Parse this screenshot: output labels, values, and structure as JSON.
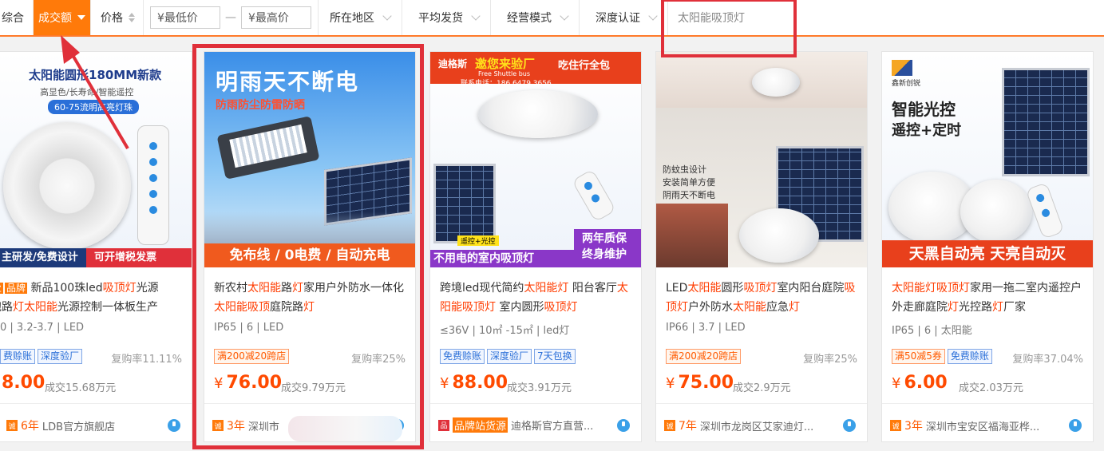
{
  "filter_bar": {
    "first_item": "综合",
    "active_sort": "成交额",
    "price_sort": "价格",
    "min_price_placeholder": "¥最低价",
    "price_sep": "—",
    "max_price_placeholder": "¥最高价",
    "region": "所在地区",
    "avg_ship": "平均发货",
    "biz_mode": "经营模式",
    "deep_cert": "深度认证",
    "search_value": "太阳能吸顶灯"
  },
  "colors": {
    "accent": "#ff7a0a",
    "highlight": "#ff3c00",
    "frame_red": "#e0303a",
    "tag_blue": "#2a6fd8"
  },
  "products": [
    {
      "image_text": [
        "太阳能圆形180MM新款",
        "高显色/长寿命/智能遥控",
        "60-75流明高亮灯珠",
        "主研发/免费设计",
        "可开增税发票"
      ],
      "title_parts": [
        "",
        "新品100珠led",
        "吸顶灯",
        "光源",
        "",
        "",
        "泡路",
        "灯",
        "太阳能",
        "光源控制一体板生产"
      ],
      "badges": [
        "业",
        "品牌"
      ],
      "spec": "0 | 3.2-3.7 | LED",
      "tags": [
        {
          "text": "费赊账",
          "style": "blue"
        },
        {
          "text": "深度验厂",
          "style": "blue"
        }
      ],
      "rebuy": "复购率11.11%",
      "price": "8.00",
      "deal": "成交15.68万元",
      "years": "6年",
      "shop": "LDB官方旗舰店"
    },
    {
      "image_text": [
        "明雨天不断电",
        "防雨防尘防雷防晒",
        "免布线 / 0电费 / 自动充电"
      ],
      "title_parts": [
        "新农村",
        "太阳能",
        "路",
        "灯",
        "家用户外防水一体化",
        "太阳能",
        "吸顶",
        "庭院路",
        "灯",
        ""
      ],
      "spec": "IP65 | 6 | LED",
      "tags": [
        {
          "text": "满200减20跨店",
          "style": "orange"
        }
      ],
      "rebuy": "复购率25%",
      "price": "76.00",
      "deal": "成交9.79万元",
      "years": "3年",
      "shop": "深圳市"
    },
    {
      "image_text": [
        "迪格斯",
        "邀您来验厂",
        "吃住行全包",
        "Free Shuttle bus",
        "联系电话：186 6479 3656",
        "遥控+光控",
        "两年质保",
        "终身维护",
        "不用电的室内吸顶灯"
      ],
      "title_parts": [
        "跨境led现代简约",
        "太阳能灯",
        " 阳台客厅",
        "太阳能吸顶灯",
        " 室内圆形",
        "吸顶灯",
        "",
        "",
        "",
        ""
      ],
      "spec": "≤36V | 10㎡ -15㎡ | led灯",
      "tags": [
        {
          "text": "免费赊账",
          "style": "blue"
        },
        {
          "text": "深度验厂",
          "style": "blue"
        },
        {
          "text": "7天包换",
          "style": "blue"
        }
      ],
      "rebuy": "",
      "price": "88.00",
      "deal": "成交3.91万元",
      "years": "品牌站货源",
      "shop": "迪格斯官方直营..."
    },
    {
      "image_text": [
        "防蚊虫设计",
        "安装简单方便",
        "阴雨天不断电"
      ],
      "title_parts": [
        "LED",
        "太阳能",
        "圆形",
        "吸顶灯",
        "室内阳台庭院",
        "吸顶灯",
        "户外防水",
        "太阳能",
        "应急",
        "灯"
      ],
      "spec": "IP66 | 3.7 | LED",
      "tags": [
        {
          "text": "满200减20跨店",
          "style": "orange"
        }
      ],
      "rebuy": "复购率25%",
      "price": "75.00",
      "deal": "成交2.9万元",
      "years": "7年",
      "shop": "深圳市龙岗区艾家迪灯..."
    },
    {
      "image_text": [
        "鑫新创锐",
        "智能光控",
        "遥控+定时",
        "天黑自动亮 天亮自动灭"
      ],
      "title_parts": [
        "",
        "太阳能灯吸顶灯",
        "家用一拖二室内遥控户外走廊庭院",
        "灯",
        "光控路",
        "灯",
        "厂家",
        "",
        "",
        ""
      ],
      "spec": "IP65 | 6 | 太阳能",
      "tags": [
        {
          "text": "满50减5券",
          "style": "orange"
        },
        {
          "text": "免费赊账",
          "style": "blue"
        }
      ],
      "rebuy": "复购率37.04%",
      "price": "6.00",
      "deal": "成交2.03万元",
      "years": "3年",
      "shop": "深圳市宝安区福海亚桦..."
    }
  ]
}
